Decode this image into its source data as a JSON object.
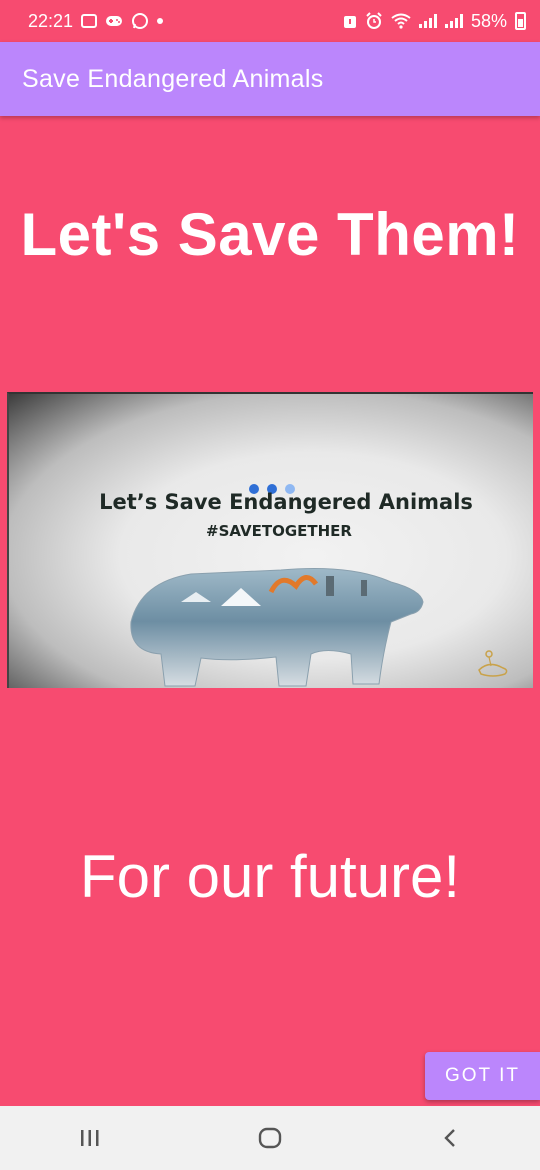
{
  "status_bar": {
    "time": "22:21",
    "battery": "58%",
    "left_icons": [
      "image-icon",
      "gamepad-icon",
      "whatsapp-icon",
      "dot-icon"
    ],
    "right_icons": [
      "alert-icon",
      "alarm-icon",
      "wifi-icon",
      "signal-icon",
      "signal-icon",
      "battery-icon"
    ]
  },
  "app_bar": {
    "title": "Save Endangered Animals"
  },
  "main": {
    "headline_top": "Let's Save Them!",
    "banner": {
      "title": "Let’s Save Endangered Animals",
      "tag": "#SAVETOGETHER",
      "loader_colors": [
        "#2F6FD6",
        "#2F6FD6",
        "#8FB8F2"
      ]
    },
    "headline_bottom": "For our future!"
  },
  "got_it_button": {
    "label": "GOT IT"
  },
  "nav_bar": {
    "items": [
      "recents-icon",
      "home-icon",
      "back-icon"
    ]
  },
  "colors": {
    "background": "#F74B70",
    "accent": "#BB86FC",
    "nav_background": "#F1F1F1"
  }
}
